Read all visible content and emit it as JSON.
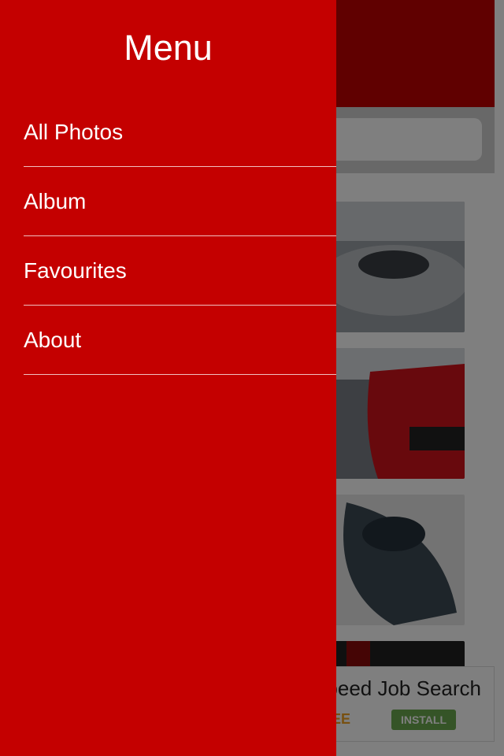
{
  "drawer": {
    "title": "Menu",
    "items": [
      {
        "label": "All Photos"
      },
      {
        "label": "Album"
      },
      {
        "label": "Favourites"
      },
      {
        "label": "About"
      }
    ]
  },
  "background": {
    "ad": {
      "title": "Speed Job Search",
      "free_label": "FREE",
      "install_label": "INSTALL"
    }
  },
  "colors": {
    "drawer_bg": "#c40000",
    "header_bg": "#c00000",
    "install_bg": "#6aa84f"
  }
}
